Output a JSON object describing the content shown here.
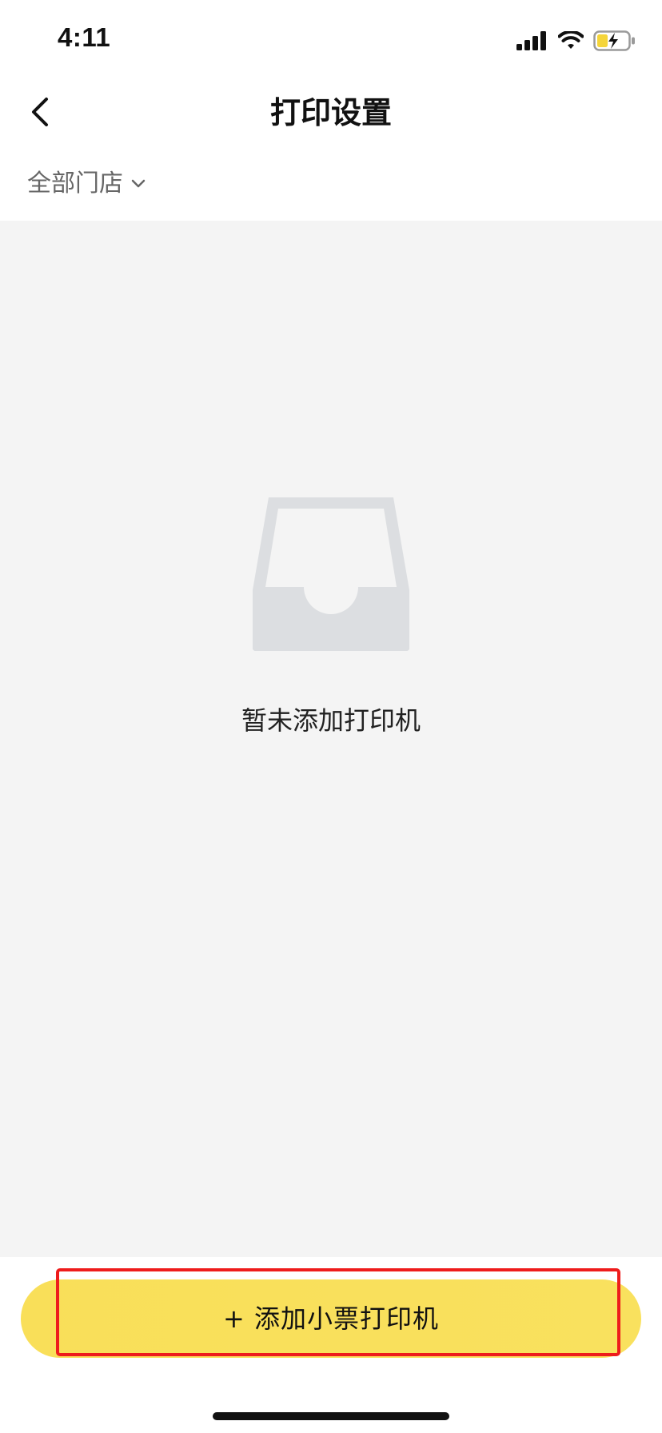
{
  "status_bar": {
    "time": "4:11",
    "icons": [
      "signal-icon",
      "wifi-icon",
      "battery-charging-icon"
    ],
    "battery_color": "#f5d53a"
  },
  "nav": {
    "back_icon": "chevron-left-icon",
    "title": "打印设置"
  },
  "filter": {
    "store_label": "全部门店",
    "dropdown_icon": "chevron-down-icon"
  },
  "empty_state": {
    "icon": "empty-tray-icon",
    "message": "暂未添加打印机"
  },
  "bottom": {
    "add_button_label": "+ 添加小票打印机",
    "button_color": "#f9df59",
    "highlight_color": "#ee1c1c"
  },
  "colors": {
    "content_background": "#f4f4f4",
    "icon_gray": "#dcdee1"
  }
}
